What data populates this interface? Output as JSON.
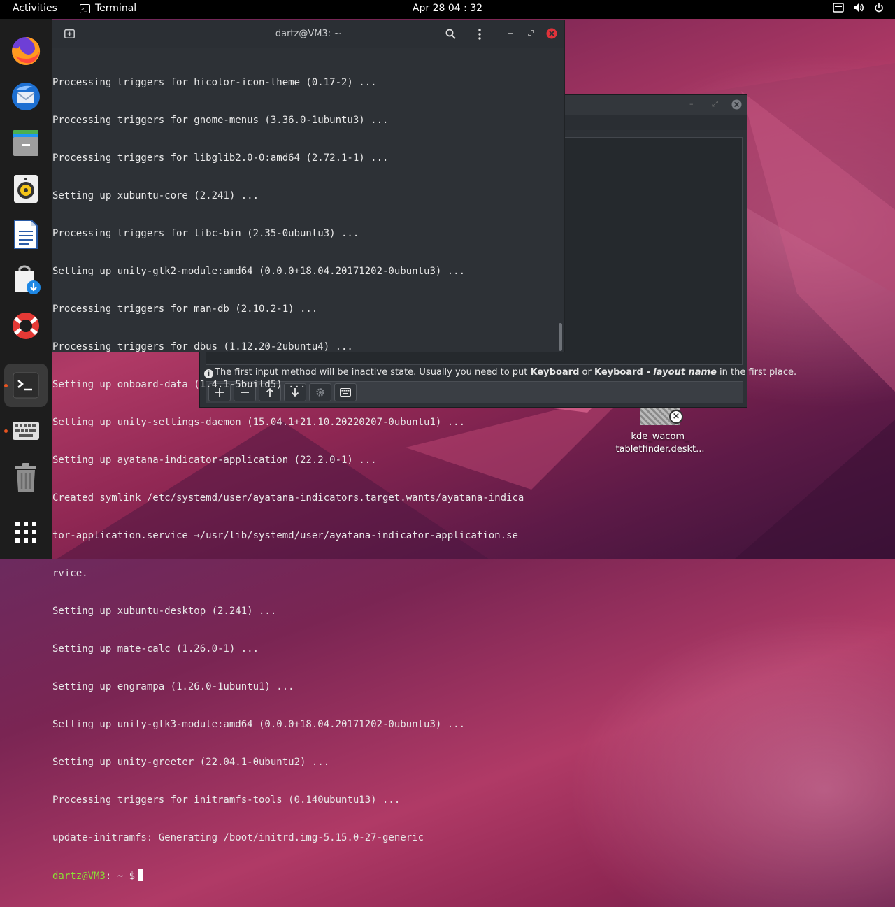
{
  "topbar": {
    "activities": "Activities",
    "app_name": "Terminal",
    "app_icon": "terminal-icon",
    "clock": "Apr 28  04 : 32",
    "tray_icons": [
      "screen-keyboard-icon",
      "volume-icon",
      "power-icon"
    ]
  },
  "dock": {
    "items": [
      {
        "name": "firefox",
        "icon": "firefox-icon"
      },
      {
        "name": "thunderbird",
        "icon": "thunderbird-icon"
      },
      {
        "name": "files",
        "icon": "files-icon"
      },
      {
        "name": "rhythmbox",
        "icon": "speaker-icon"
      },
      {
        "name": "writer",
        "icon": "document-icon"
      },
      {
        "name": "software",
        "icon": "software-store-icon"
      },
      {
        "name": "help",
        "icon": "lifebuoy-icon"
      },
      {
        "name": "terminal",
        "icon": "terminal-icon"
      },
      {
        "name": "keyboard",
        "icon": "keyboard-icon"
      },
      {
        "name": "trash",
        "icon": "trash-icon"
      },
      {
        "name": "show-apps",
        "icon": "app-grid-icon"
      }
    ]
  },
  "terminal": {
    "title": "dartz@VM3: ~",
    "lines": [
      "Processing triggers for hicolor-icon-theme (0.17-2) ...",
      "Processing triggers for gnome-menus (3.36.0-1ubuntu3) ...",
      "Processing triggers for libglib2.0-0:amd64 (2.72.1-1) ...",
      "Setting up xubuntu-core (2.241) ...",
      "Processing triggers for libc-bin (2.35-0ubuntu3) ...",
      "Setting up unity-gtk2-module:amd64 (0.0.0+18.04.20171202-0ubuntu3) ...",
      "Processing triggers for man-db (2.10.2-1) ...",
      "Processing triggers for dbus (1.12.20-2ubuntu4) ...",
      "Setting up onboard-data (1.4.1-5build5) ...",
      "Setting up unity-settings-daemon (15.04.1+21.10.20220207-0ubuntu1) ...",
      "Setting up ayatana-indicator-application (22.2.0-1) ...",
      "Created symlink /etc/systemd/user/ayatana-indicators.target.wants/ayatana-indica",
      "tor-application.service →/usr/lib/systemd/user/ayatana-indicator-application.se",
      "rvice.",
      "Setting up xubuntu-desktop (2.241) ...",
      "Setting up mate-calc (1.26.0-1) ...",
      "Setting up engrampa (1.26.0-1ubuntu1) ...",
      "Setting up unity-gtk3-module:amd64 (0.0.0+18.04.20171202-0ubuntu3) ...",
      "Setting up unity-greeter (22.04.1-0ubuntu2) ...",
      "Processing triggers for initramfs-tools (0.140ubuntu13) ...",
      "update-initramfs: Generating /boot/initrd.img-5.15.0-27-generic"
    ],
    "prompt_user": "dartz@VM3",
    "prompt_rest": ": ~ $"
  },
  "fcitx": {
    "info_pre": "The first input method will be inactive state. Usually you need to put ",
    "info_kbd": "Keyboard",
    "info_or": " or ",
    "info_kbd2": "Keyboard - ",
    "info_layout": "layout name",
    "info_post": " in the first place.",
    "tools": [
      "add-icon",
      "remove-icon",
      "arrow-up-icon",
      "arrow-down-icon",
      "gear-icon",
      "keyboard-icon"
    ]
  },
  "desktop_icon": {
    "label_line1": "kde_wacom_",
    "label_line2": "tabletfinder.deskt..."
  }
}
